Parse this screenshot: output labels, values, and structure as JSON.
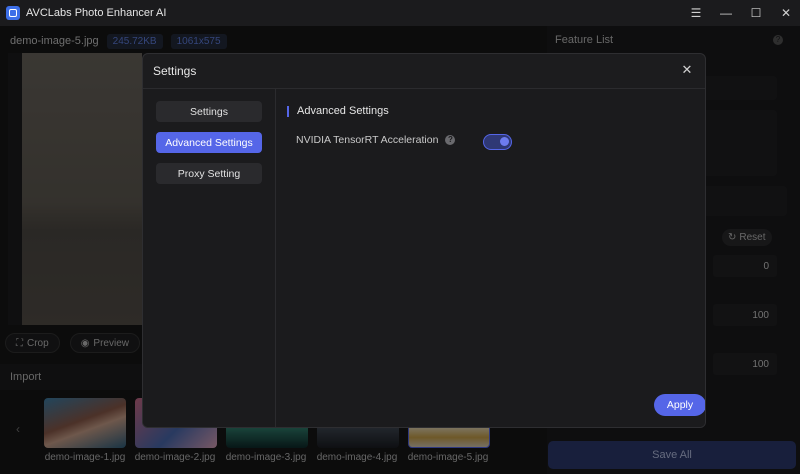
{
  "app": {
    "title": "AVCLabs Photo Enhancer AI"
  },
  "window_controls": {
    "menu": "☰",
    "minimize": "—",
    "maximize": "☐",
    "close": "✕"
  },
  "image_info": {
    "filename": "demo-image-5.jpg",
    "size": "245.72KB",
    "dimensions": "1061x575"
  },
  "tools": {
    "crop": "Crop",
    "preview": "Preview"
  },
  "import_label": "Import",
  "thumbnails": [
    {
      "name": "demo-image-1.jpg"
    },
    {
      "name": "demo-image-2.jpg"
    },
    {
      "name": "demo-image-3.jpg"
    },
    {
      "name": "demo-image-4.jpg"
    },
    {
      "name": "demo-image-5.jpg"
    }
  ],
  "right_panel": {
    "title": "Feature List",
    "reset": "Reset",
    "values": [
      "0",
      "100",
      "100"
    ],
    "save_all": "Save All"
  },
  "modal": {
    "title": "Settings",
    "close": "✕",
    "nav": [
      {
        "label": "Settings",
        "active": false
      },
      {
        "label": "Advanced Settings",
        "active": true
      },
      {
        "label": "Proxy Setting",
        "active": false
      }
    ],
    "section_title": "Advanced Settings",
    "option_label": "NVIDIA TensorRT Acceleration",
    "option_enabled": true,
    "apply": "Apply"
  },
  "colors": {
    "accent": "#5566e8"
  }
}
